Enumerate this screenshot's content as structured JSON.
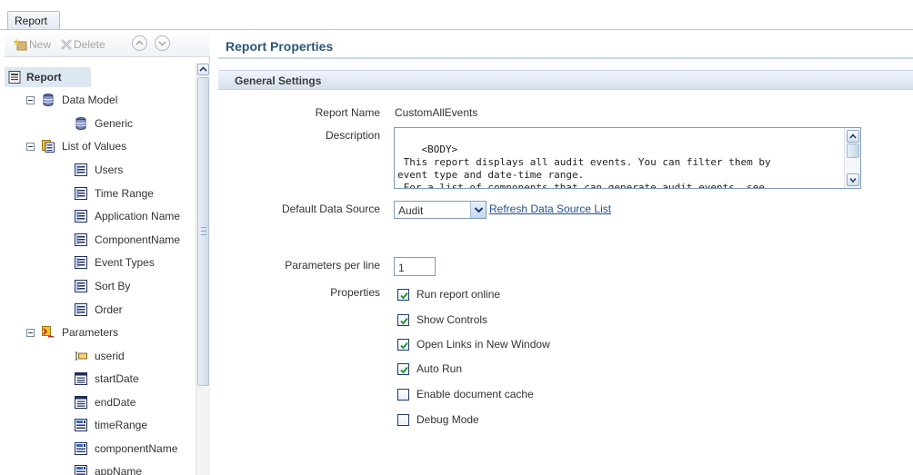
{
  "tab": {
    "label": "Report"
  },
  "toolbar": {
    "new_label": "New",
    "delete_label": "Delete"
  },
  "tree": {
    "root": "Report",
    "data_model": "Data Model",
    "generic": "Generic",
    "list_of_values": "List of Values",
    "lov_items": [
      "Users",
      "Time Range",
      "Application Name",
      "ComponentName",
      "Event Types",
      "Sort By",
      "Order"
    ],
    "parameters": "Parameters",
    "param_items": [
      "userid",
      "startDate",
      "endDate",
      "timeRange",
      "componentName",
      "appName"
    ]
  },
  "panel": {
    "title": "Report Properties",
    "section": "General Settings"
  },
  "form": {
    "report_name_label": "Report Name",
    "report_name_value": "CustomAllEvents",
    "description_label": "Description",
    "description_text": "<BODY>\n This report displays all audit events. You can filter them by\nevent type and date-time range.\n For a list of components that can generate audit events, see",
    "data_source_label": "Default Data Source",
    "data_source_value": "Audit",
    "refresh_link": "Refresh Data Source List",
    "params_per_line_label": "Parameters per line",
    "params_per_line_value": "1",
    "properties_label": "Properties"
  },
  "properties": [
    {
      "label": "Run report online",
      "checked": true
    },
    {
      "label": "Show Controls",
      "checked": true
    },
    {
      "label": "Open Links in New Window",
      "checked": true
    },
    {
      "label": "Auto Run",
      "checked": true
    },
    {
      "label": "Enable document cache",
      "checked": false
    },
    {
      "label": "Debug Mode",
      "checked": false
    }
  ],
  "colors": {
    "accent": "#2f5678",
    "link": "#1f4e93",
    "selection": "#dde8f3",
    "check": "#1c8f2a"
  }
}
